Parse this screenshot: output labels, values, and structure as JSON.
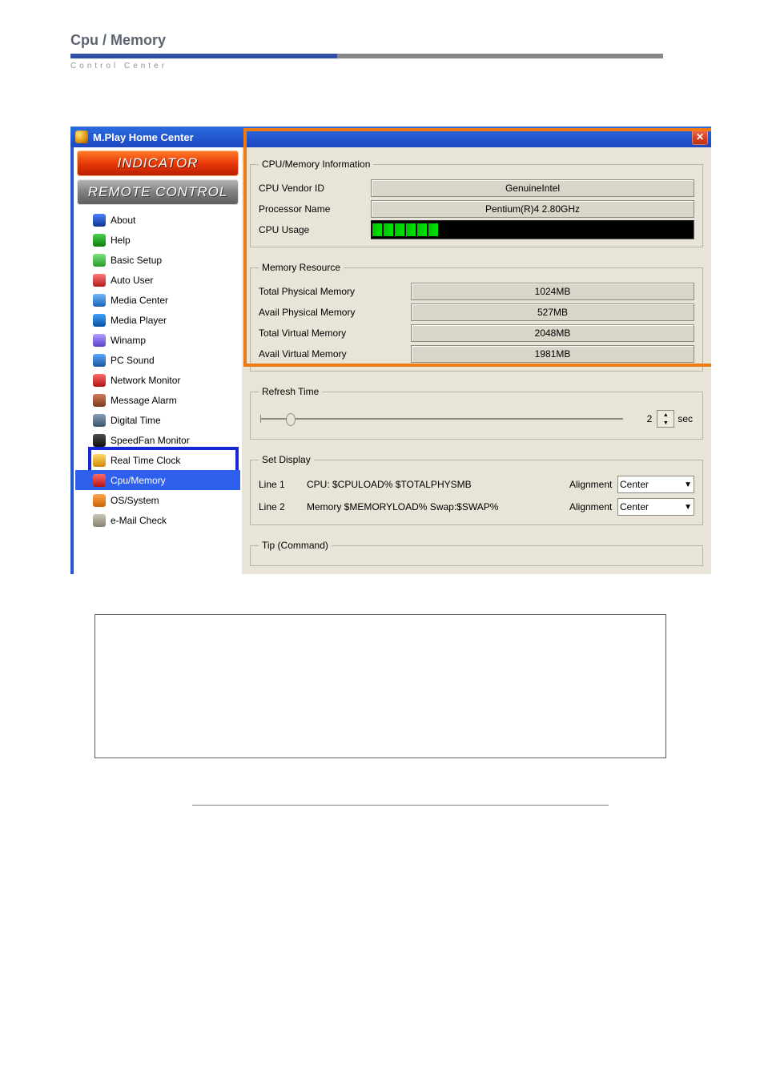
{
  "header": {
    "title": "Cpu / Memory",
    "subtitle": "Control Center"
  },
  "window": {
    "title": "M.Play Home Center"
  },
  "sidebar": {
    "banners": {
      "indicator": "INDICATOR",
      "remote": "REMOTE CONTROL"
    },
    "items": [
      {
        "label": "About"
      },
      {
        "label": "Help"
      },
      {
        "label": "Basic Setup"
      },
      {
        "label": "Auto User"
      },
      {
        "label": "Media Center"
      },
      {
        "label": "Media Player"
      },
      {
        "label": "Winamp"
      },
      {
        "label": "PC Sound"
      },
      {
        "label": "Network Monitor"
      },
      {
        "label": "Message Alarm"
      },
      {
        "label": "Digital Time"
      },
      {
        "label": "SpeedFan Monitor"
      },
      {
        "label": "Real Time Clock"
      },
      {
        "label": "Cpu/Memory"
      },
      {
        "label": "OS/System"
      },
      {
        "label": "e-Mail Check"
      }
    ]
  },
  "cpu_info": {
    "legend": "CPU/Memory Information",
    "vendor_label": "CPU Vendor ID",
    "vendor_value": "GenuineIntel",
    "proc_label": "Processor Name",
    "proc_value": "Pentium(R)4 2.80GHz",
    "usage_label": "CPU  Usage"
  },
  "mem": {
    "legend": "Memory Resource",
    "rows": [
      {
        "label": "Total Physical Memory",
        "value": "1024MB"
      },
      {
        "label": "Avail Physical Memory",
        "value": "527MB"
      },
      {
        "label": "Total Virtual Memory",
        "value": "2048MB"
      },
      {
        "label": "Avail Virtual Memory",
        "value": "1981MB"
      }
    ]
  },
  "refresh": {
    "legend": "Refresh Time",
    "value": "2",
    "unit": "sec"
  },
  "display": {
    "legend": "Set Display",
    "line1_label": "Line 1",
    "line1_value": "CPU: $CPULOAD% $TOTALPHYSMB",
    "line2_label": "Line 2",
    "line2_value": "Memory $MEMORYLOAD% Swap:$SWAP%",
    "align_label": "Alignment",
    "align_value": "Center"
  },
  "tip": {
    "legend": "Tip (Command)"
  }
}
